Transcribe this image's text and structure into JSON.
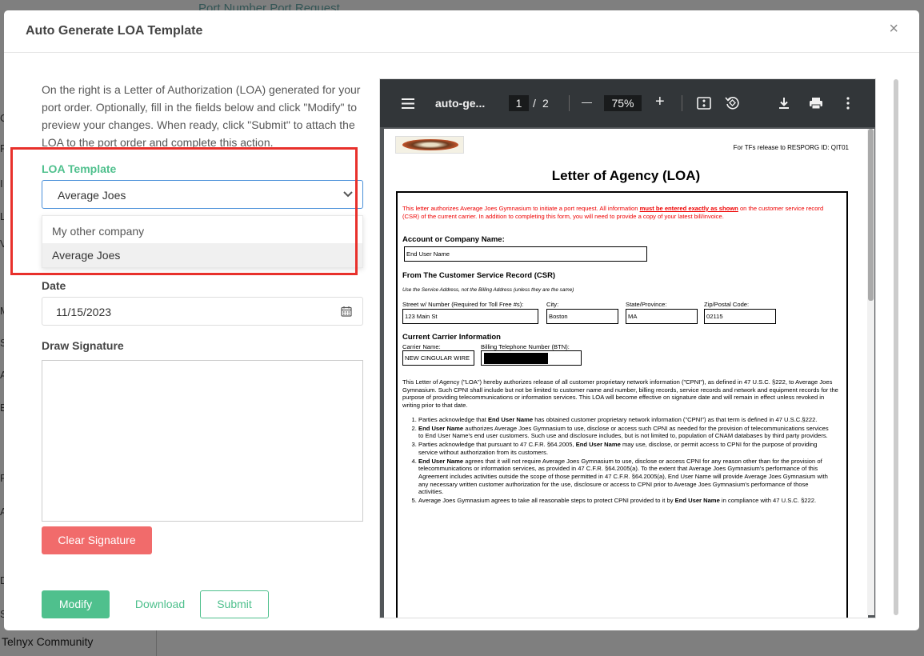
{
  "background": {
    "header_text": "Port Number Port Request",
    "community": "Telnyx Community",
    "sidebar_letters": [
      "C",
      "F",
      "I",
      "L",
      "V",
      "M",
      "S",
      "A",
      "B",
      "P",
      "A",
      "D",
      "S"
    ]
  },
  "modal": {
    "title": "Auto Generate LOA Template",
    "close_icon": "×"
  },
  "form": {
    "intro": "On the right is a Letter of Authorization (LOA) generated for your port order. Optionally, fill in the fields below and click \"Modify\" to preview your changes. When ready, click \"Submit\" to attach the LOA to the port order and complete this action.",
    "loa_template_label": "LOA Template",
    "loa_template_value": "Average Joes",
    "dropdown_options": [
      "My other company",
      "Average Joes"
    ],
    "date_label": "Date",
    "date_value": "11/15/2023",
    "signature_label": "Draw Signature",
    "clear_signature": "Clear Signature",
    "modify": "Modify",
    "download": "Download",
    "submit": "Submit"
  },
  "pdf_viewer": {
    "filename": "auto-ge...",
    "page_current": "1",
    "page_sep": "/",
    "page_total": "2",
    "zoom": "75%",
    "minus": "—",
    "plus": "+"
  },
  "pdf_doc": {
    "top_right": "For TFs release to RESPORG ID: QIT01",
    "heading": "Letter of Agency (LOA)",
    "auth_text_1": "This letter authorizes Average Joes Gymnasium to initiate a port request. All information ",
    "auth_text_bold": "must be entered exactly as shown",
    "auth_text_2": " on the customer service record (CSR) of the current carrier. In addition to completing this form, you will need to provide a copy of your latest bill/invoice.",
    "account_label": "Account or Company Name:",
    "account_value": "End User Name",
    "csr_heading": "From The Customer Service Record (CSR)",
    "csr_note": "Use the Service Address, not the Billing Address (unless they are the same)",
    "street_label": "Street w/ Number (Required for Toll Free #s):",
    "street_value": "123 Main St",
    "city_label": "City:",
    "city_value": "Boston",
    "state_label": "State/Province:",
    "state_value": "MA",
    "zip_label": "Zip/Postal Code:",
    "zip_value": "02115",
    "carrier_heading": "Current Carrier Information",
    "carrier_label": "Carrier Name:",
    "carrier_value": "NEW CINGULAR WIRE",
    "btn_label": "Billing Telephone Number (BTN):",
    "agency_paragraph": "This Letter of Agency (\"LOA\") hereby authorizes release of all customer proprietary network information (\"CPNI\"), as defined in 47 U.S.C. §222, to Average Joes Gymnasium. Such CPNI shall include but not be limited to customer name and number, billing records, service records and network and equipment records for the purpose of providing telecommunications or information services. This LOA will become effective on signature date and will remain in effect unless revoked in writing prior to that date.",
    "list": [
      {
        "pre": "Parties acknowledge that ",
        "b": "End User Name",
        "post": " has obtained customer proprietary network information (\"CPNI\") as that term is defined in 47 U.S.C.§222."
      },
      {
        "pre": "",
        "b": "End User Name",
        "post": " authorizes Average Joes Gymnasium to use, disclose or access such CPNI as needed for the provision of telecommunications services to End User Name's end user customers. Such use and disclosure includes, but is not limited to, population of CNAM databases by third party providers."
      },
      {
        "pre": "Parties acknowledge that pursuant to 47 C.F.R. §64.2005, ",
        "b": "End User Name",
        "post": " may use, disclose, or permit access to CPNI for the purpose of providing service without authorization from its customers."
      },
      {
        "pre": "",
        "b": "End User Name",
        "post": " agrees that it will not require Average Joes Gymnasium to use, disclose or access CPNI for any reason other than for the provision of telecommunications or information services, as provided in 47 C.F.R. §64.2005(a). To the extent that Average Joes Gymnasium's performance of this Agreement includes activities outside the scope of those permitted in 47 C.F.R. §64.2005(a), End User Name will provide Average Joes Gymnasium with any necessary written customer authorization for the use, disclosure or access to CPNI prior to Average Joes Gymnasium's performance of those activities."
      },
      {
        "pre": "Average Joes Gymnasium agrees to take all reasonable steps to protect CPNI provided to it by ",
        "b": "End User Name",
        "post": " in compliance with 47 U.S.C. §222."
      }
    ]
  },
  "colors": {
    "accent_green": "#4fc08d",
    "danger_red": "#f16b6b",
    "highlight_red": "#e8302b",
    "focus_blue": "#4a90d9",
    "pdf_toolbar": "#323639"
  }
}
